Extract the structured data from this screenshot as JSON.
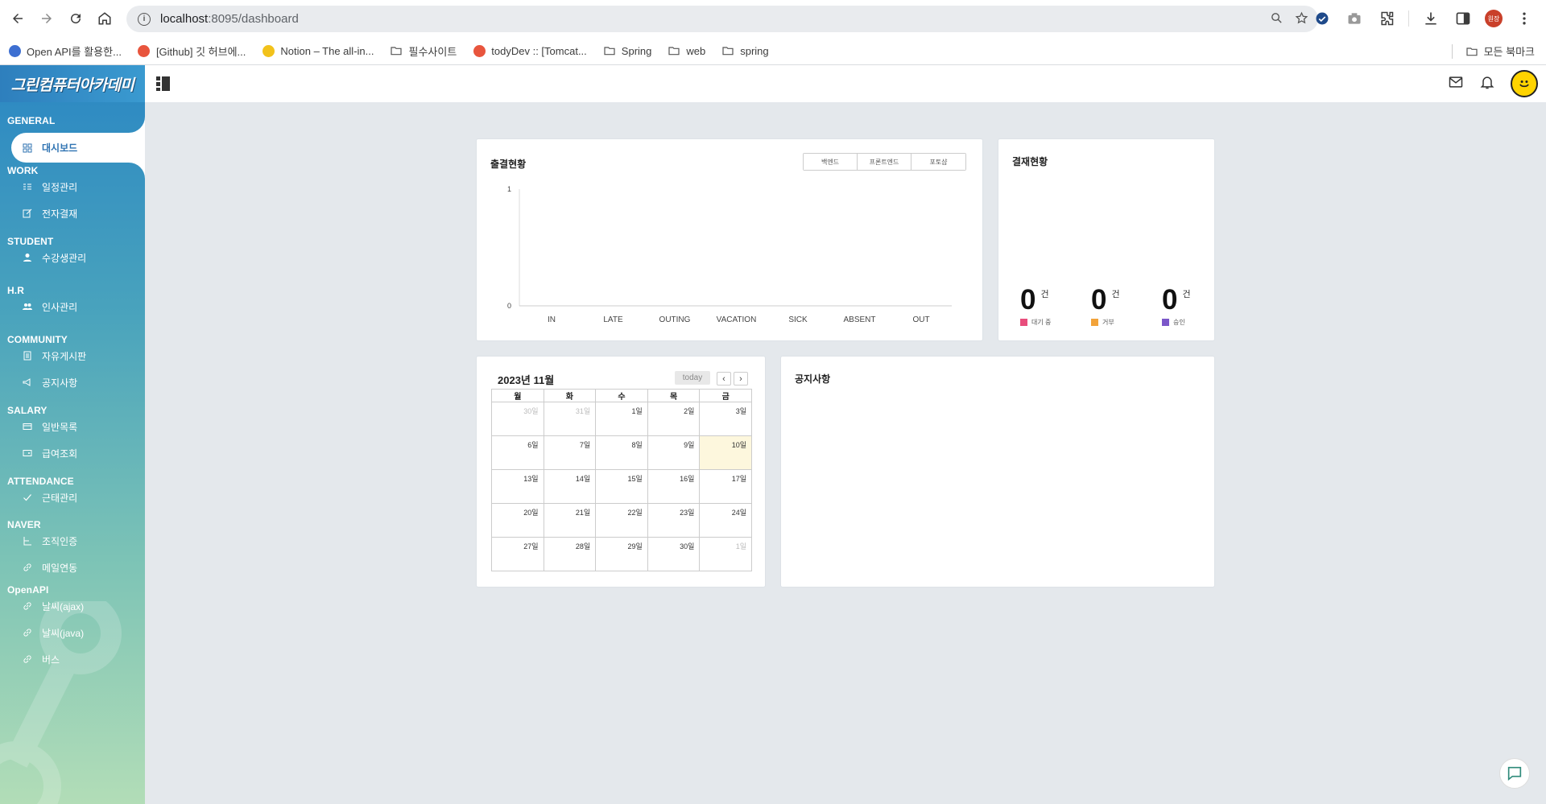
{
  "browser": {
    "url_host": "localhost",
    "url_path": ":8095/dashboard",
    "profile_label": "원장",
    "bookmarks": [
      {
        "label": "Open API를 활용한...",
        "icon": "site-icon",
        "color": "#3d6fd1"
      },
      {
        "label": "[Github] 깃 허브에...",
        "icon": "site-icon",
        "color": "#e8553d"
      },
      {
        "label": "Notion – The all-in...",
        "icon": "emoji-icon",
        "color": "#f2c21b"
      },
      {
        "label": "필수사이트",
        "icon": "folder-icon"
      },
      {
        "label": "todyDev :: [Tomcat...",
        "icon": "site-icon",
        "color": "#e8553d"
      },
      {
        "label": "Spring",
        "icon": "folder-icon"
      },
      {
        "label": "web",
        "icon": "folder-icon"
      },
      {
        "label": "spring",
        "icon": "folder-icon"
      }
    ],
    "all_bookmarks": "모든 북마크"
  },
  "app": {
    "logo": "그린컴퓨터아카데미"
  },
  "sidebar": {
    "sections": [
      {
        "title": "GENERAL",
        "items": [
          {
            "label": "대시보드",
            "icon": "dashboard-icon",
            "active": true
          }
        ]
      },
      {
        "title": "WORK",
        "items": [
          {
            "label": "일정관리",
            "icon": "schedule-icon"
          },
          {
            "label": "전자결재",
            "icon": "edit-icon"
          }
        ]
      },
      {
        "title": "STUDENT",
        "items": [
          {
            "label": "수강생관리",
            "icon": "user-icon"
          }
        ]
      },
      {
        "title": "H.R",
        "items": [
          {
            "label": "인사관리",
            "icon": "users-icon"
          }
        ]
      },
      {
        "title": "COMMUNITY",
        "items": [
          {
            "label": "자유게시판",
            "icon": "board-icon"
          },
          {
            "label": "공지사항",
            "icon": "megaphone-icon"
          }
        ]
      },
      {
        "title": "SALARY",
        "items": [
          {
            "label": "일반목록",
            "icon": "card-icon"
          },
          {
            "label": "급여조회",
            "icon": "wallet-icon"
          }
        ]
      },
      {
        "title": "ATTENDANCE",
        "items": [
          {
            "label": "근태관리",
            "icon": "check-icon"
          }
        ]
      },
      {
        "title": "NAVER",
        "items": [
          {
            "label": "조직인증",
            "icon": "org-icon"
          },
          {
            "label": "메일연동",
            "icon": "link-icon"
          }
        ]
      },
      {
        "title": "OpenAPI",
        "items": [
          {
            "label": "날씨(ajax)",
            "icon": "link-icon"
          },
          {
            "label": "날씨(java)",
            "icon": "link-icon"
          },
          {
            "label": "버스",
            "icon": "link-icon"
          }
        ]
      }
    ]
  },
  "attendance": {
    "title": "출결현황",
    "tabs": [
      "백엔드",
      "프론트엔드",
      "포토샵"
    ],
    "chart_data": {
      "type": "bar",
      "categories": [
        "IN",
        "LATE",
        "OUTING",
        "VACATION",
        "SICK",
        "ABSENT",
        "OUT"
      ],
      "values": [
        0,
        0,
        0,
        0,
        0,
        0,
        0
      ],
      "ylim": [
        0,
        1
      ],
      "yticks": [
        "0",
        "1"
      ],
      "title": "",
      "xlabel": "",
      "ylabel": ""
    }
  },
  "approval": {
    "title": "결재현황",
    "unit": "건",
    "stats": [
      {
        "value": "0",
        "label": "대기 중",
        "color": "#e84d7c"
      },
      {
        "value": "0",
        "label": "거부",
        "color": "#f2a33a"
      },
      {
        "value": "0",
        "label": "승인",
        "color": "#7b57c9"
      }
    ]
  },
  "calendar": {
    "title": "2023년 11월",
    "today_label": "today",
    "weekdays": [
      "월",
      "화",
      "수",
      "목",
      "금"
    ],
    "weeks": [
      [
        "30일",
        "31일",
        "1일",
        "2일",
        "3일"
      ],
      [
        "6일",
        "7일",
        "8일",
        "9일",
        "10일"
      ],
      [
        "13일",
        "14일",
        "15일",
        "16일",
        "17일"
      ],
      [
        "20일",
        "21일",
        "22일",
        "23일",
        "24일"
      ],
      [
        "27일",
        "28일",
        "29일",
        "30일",
        "1일"
      ]
    ],
    "muted": [
      "0-0",
      "0-1",
      "4-4"
    ],
    "today": "1-4"
  },
  "notice": {
    "title": "공지사항"
  }
}
